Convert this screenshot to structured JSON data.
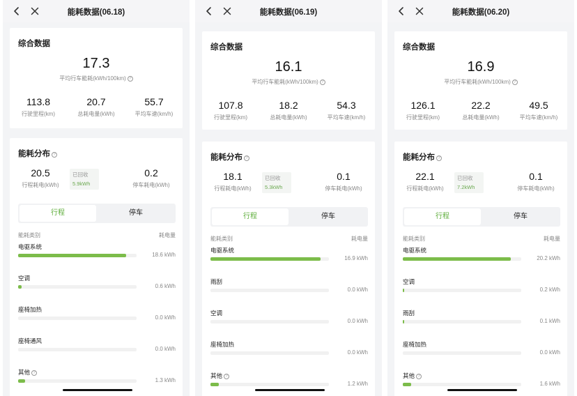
{
  "colors": {
    "accent": "#5fae3c",
    "bar": "#7cbc4a",
    "muted": "#888888"
  },
  "panels": [
    {
      "header": {
        "title": "能耗数据(06.18)"
      },
      "summary": {
        "title": "综合数据",
        "avg_value": "17.3",
        "avg_label": "平均行车能耗(kWh/100km)",
        "stats": [
          {
            "value": "113.8",
            "label": "行驶里程(km)"
          },
          {
            "value": "20.7",
            "label": "总耗电量(kWh)"
          },
          {
            "value": "55.7",
            "label": "平均车速(km/h)"
          }
        ]
      },
      "distribution": {
        "title": "能耗分布",
        "driving": {
          "value": "20.5",
          "label": "行程耗电(kWh)"
        },
        "recovered": {
          "label": "已回收",
          "value": "5.9kWh"
        },
        "parked": {
          "value": "0.2",
          "label": "停车耗电(kWh)"
        },
        "tabs": [
          "行程",
          "停车"
        ],
        "list_header": {
          "category": "能耗类别",
          "amount": "耗电量"
        },
        "items": [
          {
            "name": "电驱系统",
            "value": "18.6 kWh",
            "fraction": 0.91
          },
          {
            "name": "空调",
            "value": "0.6 kWh",
            "fraction": 0.03
          },
          {
            "name": "座椅加热",
            "value": "0.0 kWh",
            "fraction": 0
          },
          {
            "name": "座椅通风",
            "value": "0.0 kWh",
            "fraction": 0
          },
          {
            "name": "其他",
            "value": "1.3 kWh",
            "fraction": 0.06,
            "info": true
          }
        ]
      }
    },
    {
      "header": {
        "title": "能耗数据(06.19)"
      },
      "summary": {
        "title": "综合数据",
        "avg_value": "16.1",
        "avg_label": "平均行车能耗(kWh/100km)",
        "stats": [
          {
            "value": "107.8",
            "label": "行驶里程(km)"
          },
          {
            "value": "18.2",
            "label": "总耗电量(kWh)"
          },
          {
            "value": "54.3",
            "label": "平均车速(km/h)"
          }
        ]
      },
      "distribution": {
        "title": "能耗分布",
        "driving": {
          "value": "18.1",
          "label": "行程耗电(kWh)"
        },
        "recovered": {
          "label": "已回收",
          "value": "5.3kWh"
        },
        "parked": {
          "value": "0.1",
          "label": "停车耗电(kWh)"
        },
        "tabs": [
          "行程",
          "停车"
        ],
        "list_header": {
          "category": "能耗类别",
          "amount": "耗电量"
        },
        "items": [
          {
            "name": "电驱系统",
            "value": "16.9 kWh",
            "fraction": 0.93
          },
          {
            "name": "雨刮",
            "value": "0.0 kWh",
            "fraction": 0
          },
          {
            "name": "空调",
            "value": "0.0 kWh",
            "fraction": 0
          },
          {
            "name": "座椅加热",
            "value": "0.0 kWh",
            "fraction": 0
          },
          {
            "name": "其他",
            "value": "1.2 kWh",
            "fraction": 0.07,
            "info": true
          }
        ]
      }
    },
    {
      "header": {
        "title": "能耗数据(06.20)"
      },
      "summary": {
        "title": "综合数据",
        "avg_value": "16.9",
        "avg_label": "平均行车能耗(kWh/100km)",
        "stats": [
          {
            "value": "126.1",
            "label": "行驶里程(km)"
          },
          {
            "value": "22.2",
            "label": "总耗电量(kWh)"
          },
          {
            "value": "49.5",
            "label": "平均车速(km/h)"
          }
        ]
      },
      "distribution": {
        "title": "能耗分布",
        "driving": {
          "value": "22.1",
          "label": "行程耗电(kWh)"
        },
        "recovered": {
          "label": "已回收",
          "value": "7.2kWh"
        },
        "parked": {
          "value": "0.1",
          "label": "停车耗电(kWh)"
        },
        "tabs": [
          "行程",
          "停车"
        ],
        "list_header": {
          "category": "能耗类别",
          "amount": "耗电量"
        },
        "items": [
          {
            "name": "电驱系统",
            "value": "20.2 kWh",
            "fraction": 0.91
          },
          {
            "name": "空调",
            "value": "0.2 kWh",
            "fraction": 0.01
          },
          {
            "name": "雨刮",
            "value": "0.1 kWh",
            "fraction": 0.005
          },
          {
            "name": "座椅加热",
            "value": "0.0 kWh",
            "fraction": 0
          },
          {
            "name": "其他",
            "value": "1.6 kWh",
            "fraction": 0.07,
            "info": true
          }
        ]
      }
    }
  ]
}
